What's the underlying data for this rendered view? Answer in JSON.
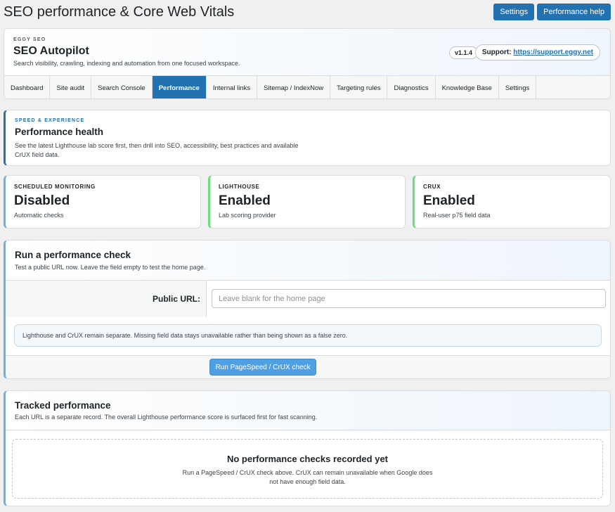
{
  "page": {
    "title": "SEO performance & Core Web Vitals",
    "actions": {
      "settings": "Settings",
      "help": "Performance help"
    }
  },
  "header": {
    "kicker": "EGGY SEO",
    "brand": "SEO Autopilot",
    "tagline": "Search visibility, crawling, indexing and automation from one focused workspace.",
    "version": "v1.1.4",
    "support_label": "Support:",
    "support_link": "https://support.eggy.net"
  },
  "tabs": [
    "Dashboard",
    "Site audit",
    "Search Console",
    "Performance",
    "Internal links",
    "Sitemap / IndexNow",
    "Targeting rules",
    "Diagnostics",
    "Knowledge Base",
    "Settings"
  ],
  "active_tab": "Performance",
  "intro": {
    "kicker": "SPEED & EXPERIENCE",
    "title": "Performance health",
    "description": "See the latest Lighthouse lab score first, then drill into SEO, accessibility, best practices and available CrUX field data."
  },
  "stats": [
    {
      "label": "SCHEDULED MONITORING",
      "value": "Disabled",
      "sub": "Automatic checks"
    },
    {
      "label": "LIGHTHOUSE",
      "value": "Enabled",
      "sub": "Lab scoring provider"
    },
    {
      "label": "CRUX",
      "value": "Enabled",
      "sub": "Real-user p75 field data"
    }
  ],
  "run_check": {
    "title": "Run a performance check",
    "description": "Test a public URL now. Leave the field empty to test the home page.",
    "url_label": "Public URL:",
    "url_placeholder": "Leave blank for the home page",
    "url_value": "",
    "note": "Lighthouse and CrUX remain separate. Missing field data stays unavailable rather than being shown as a false zero.",
    "button": "Run PageSpeed / CrUX check"
  },
  "tracked": {
    "title": "Tracked performance",
    "description": "Each URL is a separate record. The overall Lighthouse performance score is surfaced first for fast scanning.",
    "empty_title": "No performance checks recorded yet",
    "empty_desc": "Run a PageSpeed / CrUX check above. CrUX can remain unavailable when Google does not have enough field data."
  },
  "colors": {
    "primary": "#2271b1",
    "accent_blue": "#72aee6",
    "accent_green": "#68de7c",
    "button_light": "#4ea0e3"
  }
}
